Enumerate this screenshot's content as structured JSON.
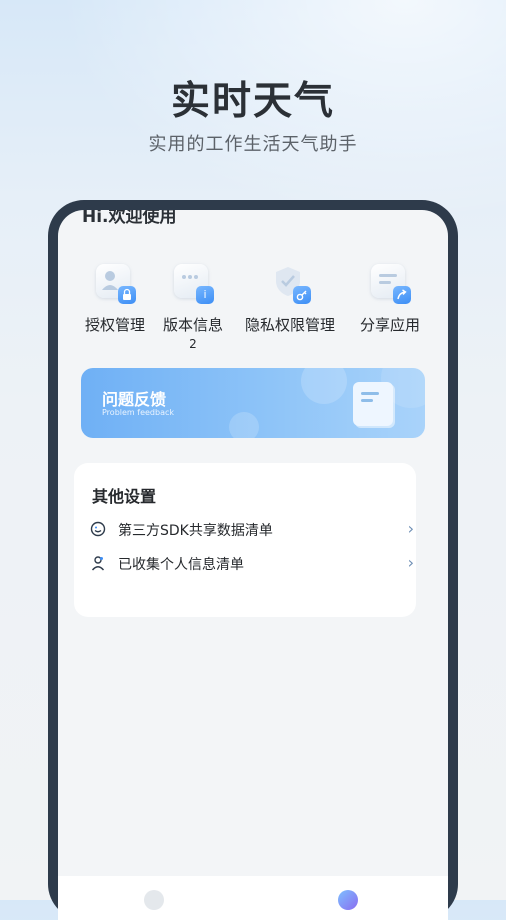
{
  "hero": {
    "title": "实时天气",
    "subtitle": "实用的工作生活天气助手"
  },
  "screen": {
    "greeting": "Hi.欢迎使用",
    "menu": [
      {
        "label": "授权管理",
        "sub": "",
        "icon": "user-lock-icon"
      },
      {
        "label": "版本信息",
        "sub": "2",
        "icon": "info-icon"
      },
      {
        "label": "隐私权限管理",
        "sub": "",
        "icon": "shield-key-icon"
      },
      {
        "label": "分享应用",
        "sub": "",
        "icon": "share-icon"
      }
    ],
    "feedback": {
      "title": "问题反馈",
      "subtitle": "Problem feedback"
    },
    "settings": {
      "title": "其他设置",
      "rows": [
        {
          "label": "第三方SDK共享数据清单",
          "icon": "sdk-share-icon"
        },
        {
          "label": "已收集个人信息清单",
          "icon": "person-list-icon"
        }
      ]
    }
  },
  "colors": {
    "accent": "#3d8ef5",
    "phone_frame": "#2e3b4b",
    "chevron": "#6e8fb5"
  }
}
